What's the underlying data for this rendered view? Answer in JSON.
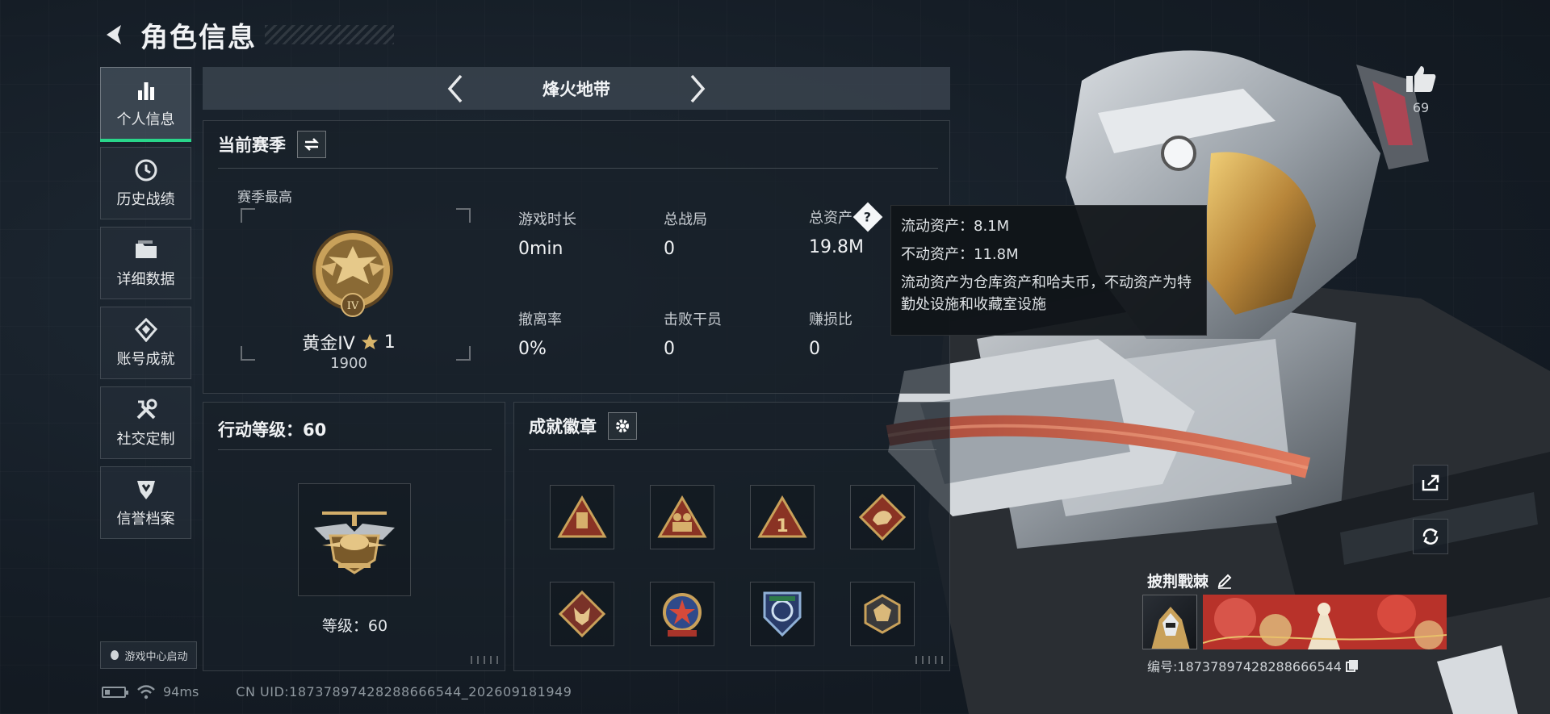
{
  "header": {
    "title": "角色信息"
  },
  "sidebar": {
    "items": [
      {
        "label": "个人信息",
        "icon": "bar-chart-icon",
        "active": true
      },
      {
        "label": "历史战绩",
        "icon": "clock-icon"
      },
      {
        "label": "详细数据",
        "icon": "folder-icon"
      },
      {
        "label": "账号成就",
        "icon": "achievement-icon"
      },
      {
        "label": "社交定制",
        "icon": "tools-icon"
      },
      {
        "label": "信誉档案",
        "icon": "shield-icon"
      }
    ],
    "game_center_label": "游戏中心启动"
  },
  "mode": {
    "title": "烽火地带"
  },
  "season": {
    "title": "当前赛季",
    "best_label": "赛季最高",
    "rank_name": "黄金IV",
    "rank_stars": "1",
    "rank_score": "1900",
    "stats": [
      {
        "label": "游戏时长",
        "value": "0min"
      },
      {
        "label": "总战局",
        "value": "0"
      },
      {
        "label": "总资产",
        "value": "19.8M",
        "has_help": true
      },
      {
        "label": "撤离率",
        "value": "0%"
      },
      {
        "label": "击败干员",
        "value": "0"
      },
      {
        "label": "赚损比",
        "value": "0"
      }
    ]
  },
  "tooltip": {
    "liquid": "流动资产：8.1M",
    "fixed": "不动资产：11.8M",
    "desc": "流动资产为仓库资产和哈夫币，不动资产为特勤处设施和收藏室设施"
  },
  "level": {
    "title": "行动等级：60",
    "caption": "等级：60"
  },
  "achievements": {
    "title": "成就徽章",
    "medals": [
      "bag-medal-icon",
      "soldiers-medal-icon",
      "number-one-medal-icon",
      "dragon-medal-icon",
      "wolf-medal-icon",
      "star-wreath-medal-icon",
      "arrows-shield-medal-icon",
      "gem-medal-icon"
    ]
  },
  "profile": {
    "likes": "69",
    "name": "披荆戰棘",
    "id": "编号:18737897428288666544"
  },
  "status": {
    "ping": "94ms",
    "uid": "CN UID:18737897428288666544_202609181949"
  },
  "colors": {
    "accent": "#29d58a",
    "gold": "#c9a15a",
    "panel": "#18202a"
  }
}
